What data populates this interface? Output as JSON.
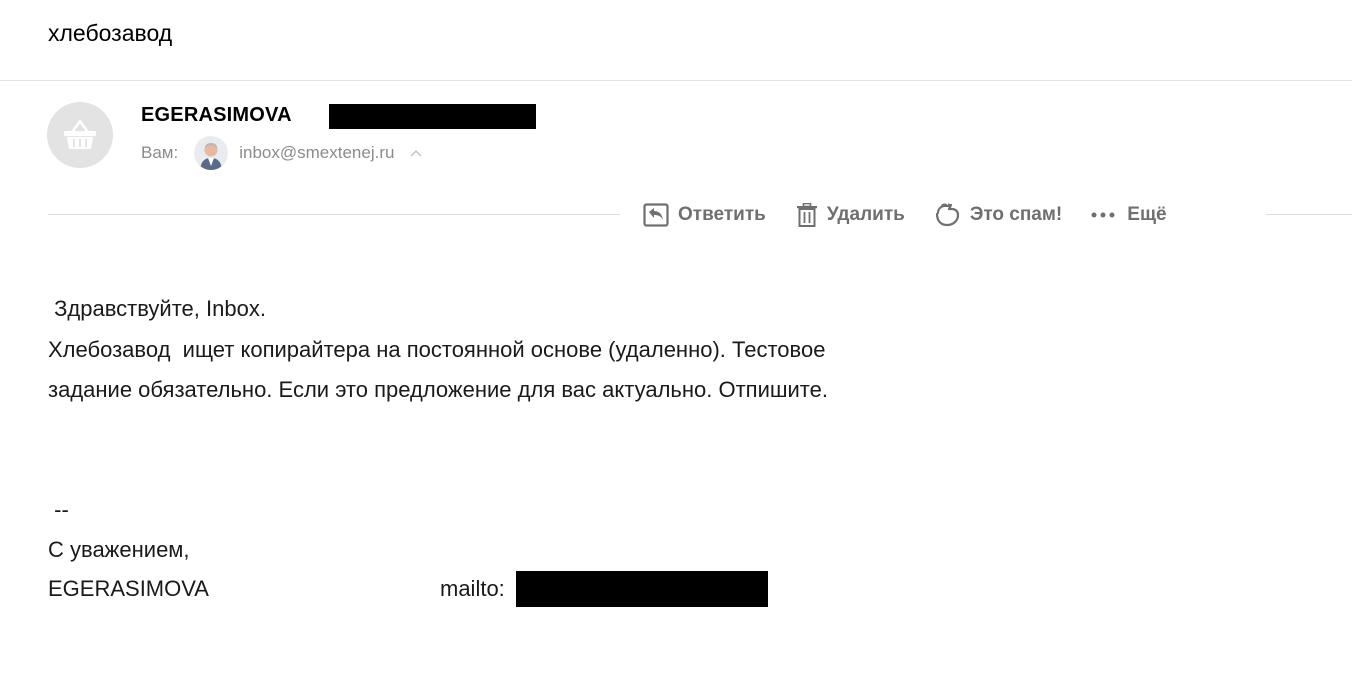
{
  "message": {
    "subject": "хлебозавод",
    "sender_name": "EGERASIMOVA",
    "to_label": "Вам:",
    "to_email": "inbox@smextenej.ru"
  },
  "toolbar": {
    "reply_label": "Ответить",
    "delete_label": "Удалить",
    "spam_label": "Это спам!",
    "more_label": "Ещё"
  },
  "body": {
    "greeting": " Здравствуйте, Inbox.",
    "line1": "Хлебозавод  ищет копирайтера на постоянной основе (удаленно). Тестовое",
    "line2": "задание обязательно. Если это предложение для вас актуально. Отпишите.",
    "sig_dash": " --",
    "sig_regards": "С уважением,",
    "sig_name": "EGERASIMOVA",
    "sig_mailto": "mailto:"
  },
  "icons": {
    "avatar": "basket-icon",
    "reply": "reply-icon",
    "delete": "trash-icon",
    "spam": "thumb-down-icon",
    "more": "more-dots-icon",
    "collapse": "chevron-up-icon"
  },
  "colors": {
    "muted_text": "#8c8c8c",
    "toolbar_text": "#6f6f6f",
    "avatar_bg": "#e3e3e3",
    "redaction": "#000000"
  }
}
